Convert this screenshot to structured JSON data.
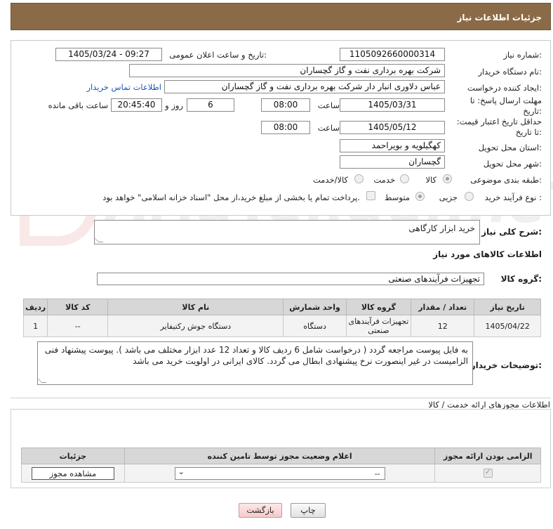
{
  "header": {
    "title": "جزئیات اطلاعات نیاز"
  },
  "form": {
    "need_number_label": "شماره نیاز:",
    "need_number": "1105092660000314",
    "announce_label": "تاریخ و ساعت اعلان عمومی:",
    "announce_value": "1405/03/24 - 09:27",
    "buyer_label": "نام دستگاه خریدار:",
    "buyer_value": "شرکت بهره برداری نفت و گاز گچساران",
    "creator_label": "ایجاد کننده درخواست:",
    "creator_value": "عباس دلاوری انبار دار شرکت بهره برداری نفت و گاز گچساران",
    "contact_link": "اطلاعات تماس خریدار",
    "deadline_label": "مهلت ارسال پاسخ: تا تاریخ:",
    "deadline_date": "1405/03/31",
    "time_label": "ساعت",
    "deadline_time": "08:00",
    "days_value": "6",
    "days_label": "روز و",
    "remaining_value": "20:45:40",
    "remaining_label": "ساعت باقی مانده",
    "price_label": "حداقل تاریخ اعتبار قیمت: تا تاریخ:",
    "price_date": "1405/05/12",
    "price_time_label": "ساعت",
    "price_time": "08:00",
    "province_label": "استان محل تحویل:",
    "province_value": "کهگیلویه و بویراحمد",
    "city_label": "شهر محل تحویل:",
    "city_value": "گچساران",
    "category_label": "طبقه بندی موضوعی:",
    "category_options": [
      "کالا",
      "خدمت",
      "کالا/خدمت"
    ],
    "category_selected": "کالا",
    "process_label": "نوع فرآیند خرید :",
    "process_options": [
      "جزیی",
      "متوسط"
    ],
    "process_selected": "متوسط",
    "payment_note": "پرداخت تمام یا بخشی از مبلغ خرید،از محل \"اسناد خزانه اسلامی\" خواهد بود."
  },
  "summary": {
    "label": "شرح کلی نیاز:",
    "value": "خرید ابزار کارگاهی"
  },
  "goods": {
    "section_title": "اطلاعات کالاهای مورد نیاز",
    "group_label": "گروه کالا:",
    "group_value": "تجهیزات فرآیندهای صنعتی",
    "columns": [
      "ردیف",
      "کد کالا",
      "نام کالا",
      "واحد شمارش",
      "گروه کالا",
      "تعداد / مقدار",
      "تاریخ نیاز"
    ],
    "rows": [
      [
        "1",
        "--",
        "دستگاه جوش رکتیفایر",
        "دستگاه",
        "تجهیزات فرآیندهای صنعتی",
        "12",
        "1405/04/22"
      ]
    ]
  },
  "buyer_notes": {
    "label": "توضیحات خریدار:",
    "value": "به فایل پیوست مراجعه گردد ( درخواست شامل 6 ردیف کالا و تعداد 12 عدد ابزار مختلف می باشد ). پیوست پیشنهاد فنی الزامیست در غیر اینصورت نرخ پیشنهادی ابطال می گردد. کالای ایرانی در اولویت خرید می باشد"
  },
  "permits": {
    "section_title": "اطلاعات مجوزهای ارائه خدمت / کالا",
    "columns": [
      "الزامی بودن ارائه مجوز",
      "اعلام وضعیت مجوز توسط تامین کننده",
      "جزئیات"
    ],
    "select_value": "--",
    "view_button": "مشاهده مجوز"
  },
  "actions": {
    "print": "چاپ",
    "back": "بازگشت"
  },
  "watermark": {
    "text": "AriaTender.neT"
  }
}
